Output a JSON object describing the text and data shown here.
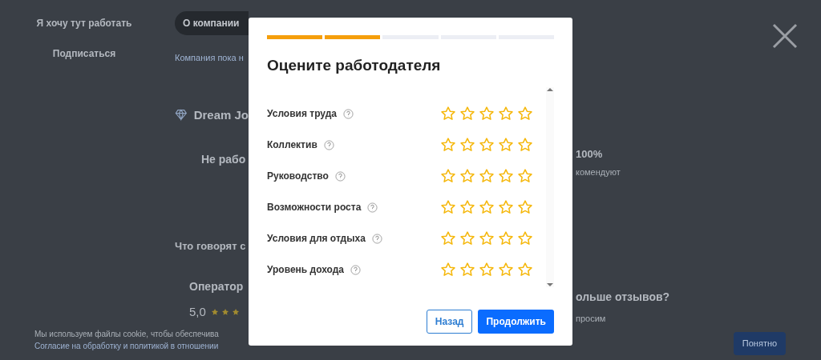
{
  "page": {
    "sidebar_buttons": [
      "Я хочу тут работать",
      "Подписаться"
    ],
    "tab": {
      "label": "О компании",
      "selected": true
    },
    "note": "Компания пока н",
    "company": "Dream Jo",
    "status": "Не рабо",
    "percent": "100%",
    "percent_caption": "комендуют",
    "reviews_heading": "Что говорят с",
    "review_title": "Оператор",
    "review_score": "5,0",
    "more_heading": "ольше отзывов?",
    "more_caption": "просим"
  },
  "cookie": {
    "text": "Мы используем файлы cookie, чтобы обеспечива",
    "link": "Согласие на обработку и политикой в отношении",
    "button": "Понятно"
  },
  "modal": {
    "steps": [
      {
        "done": true
      },
      {
        "done": true
      },
      {
        "done": false
      },
      {
        "done": false
      },
      {
        "done": false
      }
    ],
    "title": "Оцените работодателя",
    "criteria": [
      {
        "label": "Условия труда",
        "stars": 0
      },
      {
        "label": "Коллектив",
        "stars": 0
      },
      {
        "label": "Руководство",
        "stars": 0
      },
      {
        "label": "Возможности роста",
        "stars": 0
      },
      {
        "label": "Условия для отдыха",
        "stars": 0
      },
      {
        "label": "Уровень дохода",
        "stars": 0
      }
    ],
    "buttons": [
      {
        "label": "Назад",
        "kind": "secondary"
      },
      {
        "label": "Продолжить",
        "kind": "primary"
      }
    ]
  }
}
